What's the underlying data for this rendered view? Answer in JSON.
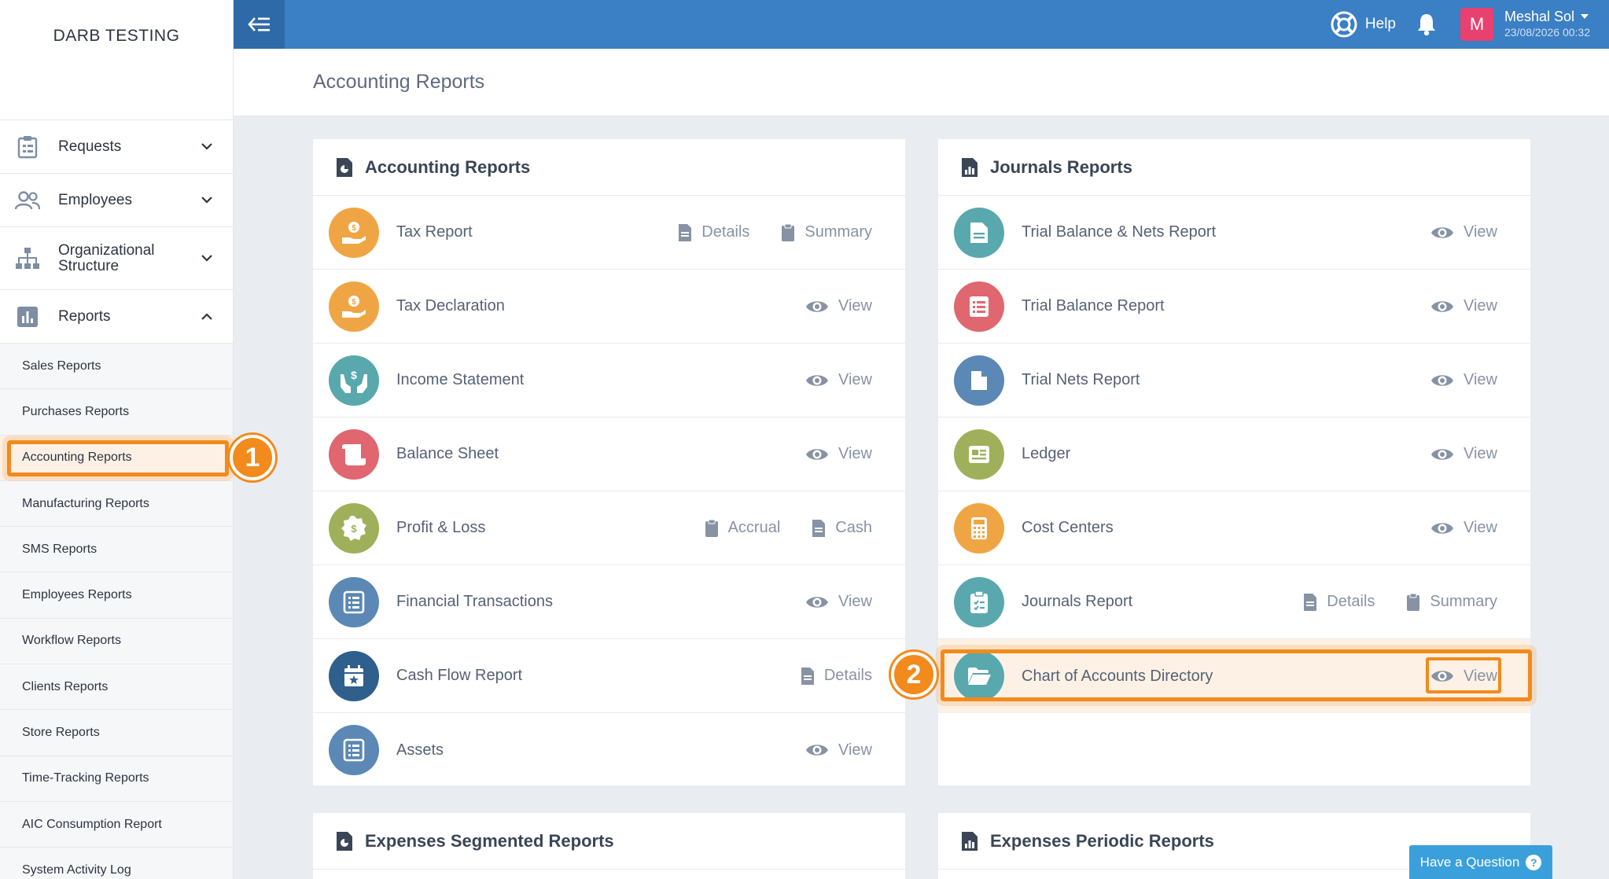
{
  "brand": "DARB TESTING",
  "topbar": {
    "help_label": "Help",
    "user_initial": "M",
    "user_name": "Meshal Sol",
    "user_datetime": "23/08/2026 00:32"
  },
  "sidebar": {
    "menu": [
      {
        "label": "Requests"
      },
      {
        "label": "Employees"
      },
      {
        "label": "Organizational Structure"
      },
      {
        "label": "Reports"
      }
    ],
    "reports_submenu": [
      "Sales Reports",
      "Purchases Reports",
      "Accounting Reports",
      "Manufacturing Reports",
      "SMS Reports",
      "Employees Reports",
      "Workflow Reports",
      "Clients Reports",
      "Store Reports",
      "Time-Tracking Reports",
      "AIC Consumption Report",
      "System Activity Log"
    ]
  },
  "page_title": "Accounting Reports",
  "cards": {
    "accounting": {
      "title": "Accounting Reports",
      "rows": [
        {
          "label": "Tax Report",
          "actions": [
            "Details",
            "Summary"
          ]
        },
        {
          "label": "Tax Declaration",
          "actions": [
            "View"
          ]
        },
        {
          "label": "Income Statement",
          "actions": [
            "View"
          ]
        },
        {
          "label": "Balance Sheet",
          "actions": [
            "View"
          ]
        },
        {
          "label": "Profit & Loss",
          "actions": [
            "Accrual",
            "Cash"
          ]
        },
        {
          "label": "Financial Transactions",
          "actions": [
            "View"
          ]
        },
        {
          "label": "Cash Flow Report",
          "actions": [
            "Details"
          ]
        },
        {
          "label": "Assets",
          "actions": [
            "View"
          ]
        }
      ]
    },
    "journals": {
      "title": "Journals Reports",
      "rows": [
        {
          "label": "Trial Balance & Nets Report",
          "actions": [
            "View"
          ]
        },
        {
          "label": "Trial Balance Report",
          "actions": [
            "View"
          ]
        },
        {
          "label": "Trial Nets Report",
          "actions": [
            "View"
          ]
        },
        {
          "label": "Ledger",
          "actions": [
            "View"
          ]
        },
        {
          "label": "Cost Centers",
          "actions": [
            "View"
          ]
        },
        {
          "label": "Journals Report",
          "actions": [
            "Details",
            "Summary"
          ]
        },
        {
          "label": "Chart of Accounts Directory",
          "actions": [
            "View"
          ]
        }
      ]
    },
    "expenses_segmented": {
      "title": "Expenses Segmented Reports"
    },
    "expenses_periodic": {
      "title": "Expenses Periodic Reports"
    }
  },
  "steps": [
    "1",
    "2"
  ],
  "question_button": "Have a Question",
  "colors": {
    "topbar": "#3b7fc4",
    "highlight": "#f28a1c",
    "orange": "#f0a544",
    "teal": "#58a8ae",
    "red": "#e0676f",
    "olive": "#9fb05a",
    "blue": "#5b88b4",
    "navy": "#2f5f8c"
  }
}
